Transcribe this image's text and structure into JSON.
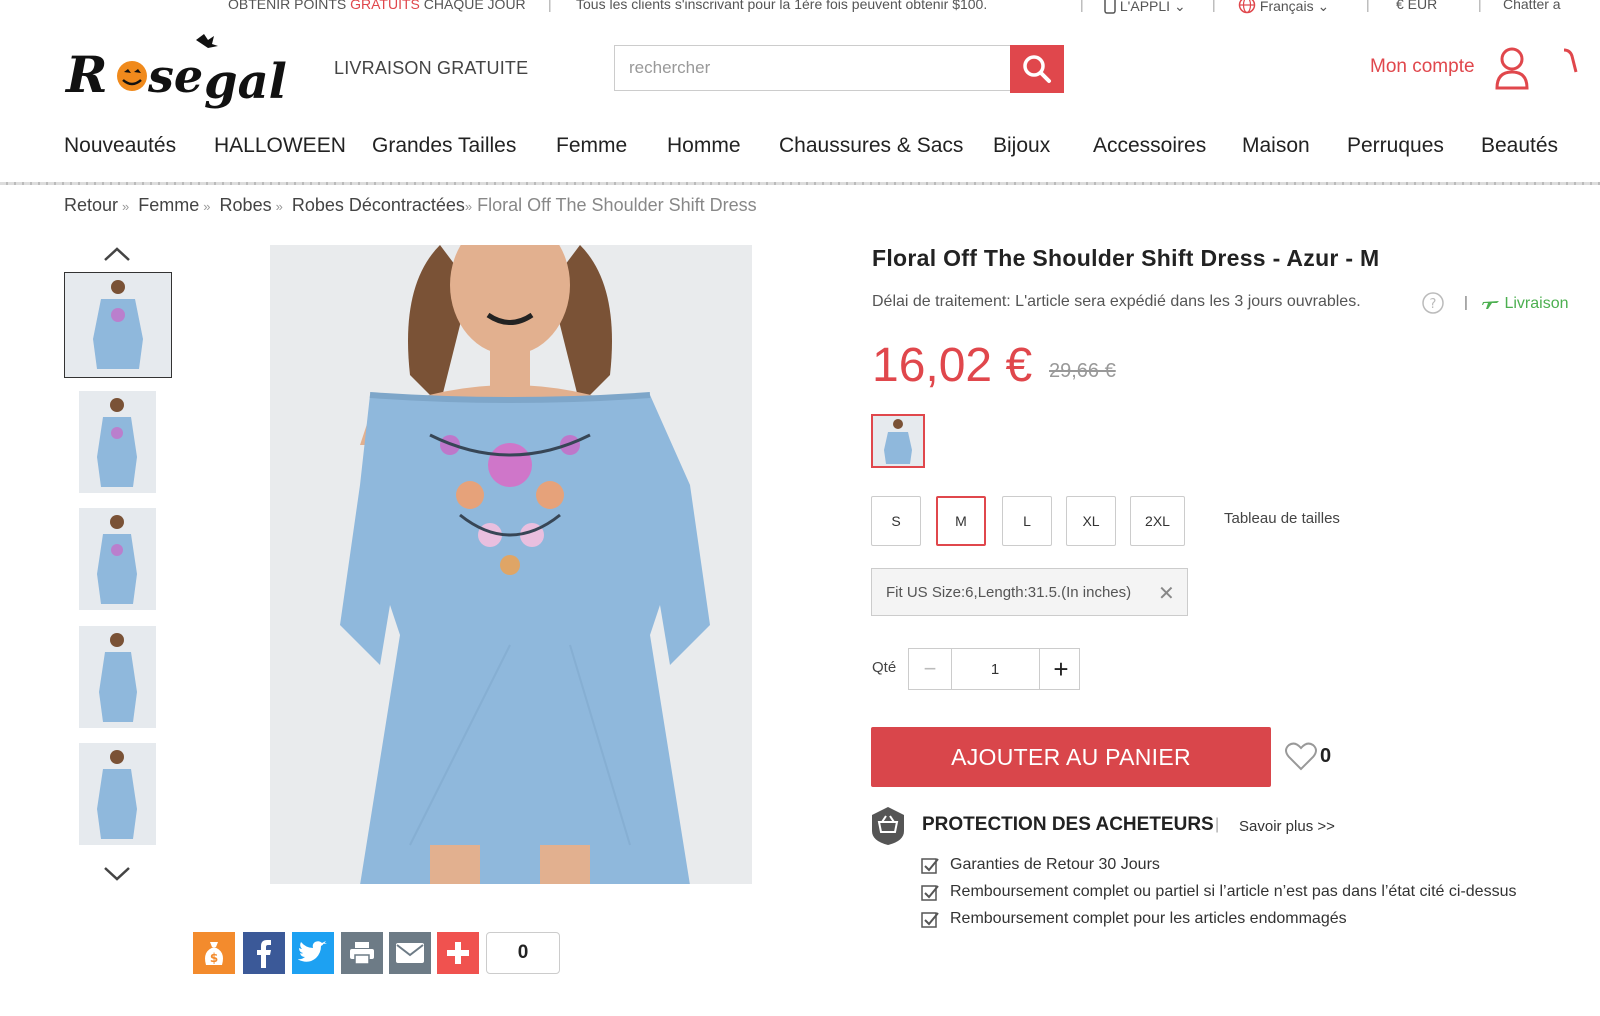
{
  "topbar": {
    "points_pre": "OBTENIR POINTS ",
    "points_hl": "GRATUITS",
    "points_post": " CHAQUE JOUR",
    "promo": "Tous les clients s'inscrivant pour la 1ère fois peuvent obtenir $100.",
    "app": "L'APPLI",
    "language": "Français",
    "currency": "€ EUR",
    "chat": "Chatter a"
  },
  "header": {
    "logo_text": "Rosegal",
    "free_shipping": "LIVRAISON GRATUITE",
    "search_placeholder": "rechercher",
    "account": "Mon compte"
  },
  "nav": [
    "Nouveautés",
    "HALLOWEEN",
    "Grandes Tailles",
    "Femme",
    "Homme",
    "Chaussures & Sacs",
    "Bijoux",
    "Accessoires",
    "Maison",
    "Perruques",
    "Beautés"
  ],
  "breadcrumb": {
    "items": [
      "Retour",
      "Femme",
      "Robes",
      "Robes Décontractées"
    ],
    "current": "Floral Off The Shoulder Shift Dress"
  },
  "product": {
    "title": "Floral Off The Shoulder Shift Dress - Azur - M",
    "processing": "Délai de traitement: L'article sera expédié dans les 3 jours ouvrables.",
    "shipping_link": "Livraison",
    "price": "16,02 €",
    "old_price": "29,66 €",
    "sizes": [
      "S",
      "M",
      "L",
      "XL",
      "2XL"
    ],
    "selected_size": "M",
    "size_chart": "Tableau de tailles",
    "fit_info": "Fit US Size:6,Length:31.5.(In inches)",
    "qty_label": "Qté",
    "qty_value": "1",
    "add_to_cart": "AJOUTER AU PANIER",
    "favorites": "0"
  },
  "protection": {
    "title": "PROTECTION DES ACHETEURS",
    "learn_more": "Savoir plus >>",
    "items": [
      "Garanties de Retour 30 Jours",
      "Remboursement complet ou partiel si l’article n’est pas dans l’état cité ci-dessus",
      "Remboursement complet pour les articles endommagés"
    ]
  },
  "share": {
    "count": "0"
  },
  "colors": {
    "accent": "#e0474c",
    "dress": "#8fb8dc",
    "facebook": "#3b5998",
    "twitter": "#1da1f2",
    "share_gray": "#6d7b86",
    "share_orange": "#f38b2d",
    "share_plus": "#f0524f",
    "shipping_green": "#4caf50"
  }
}
